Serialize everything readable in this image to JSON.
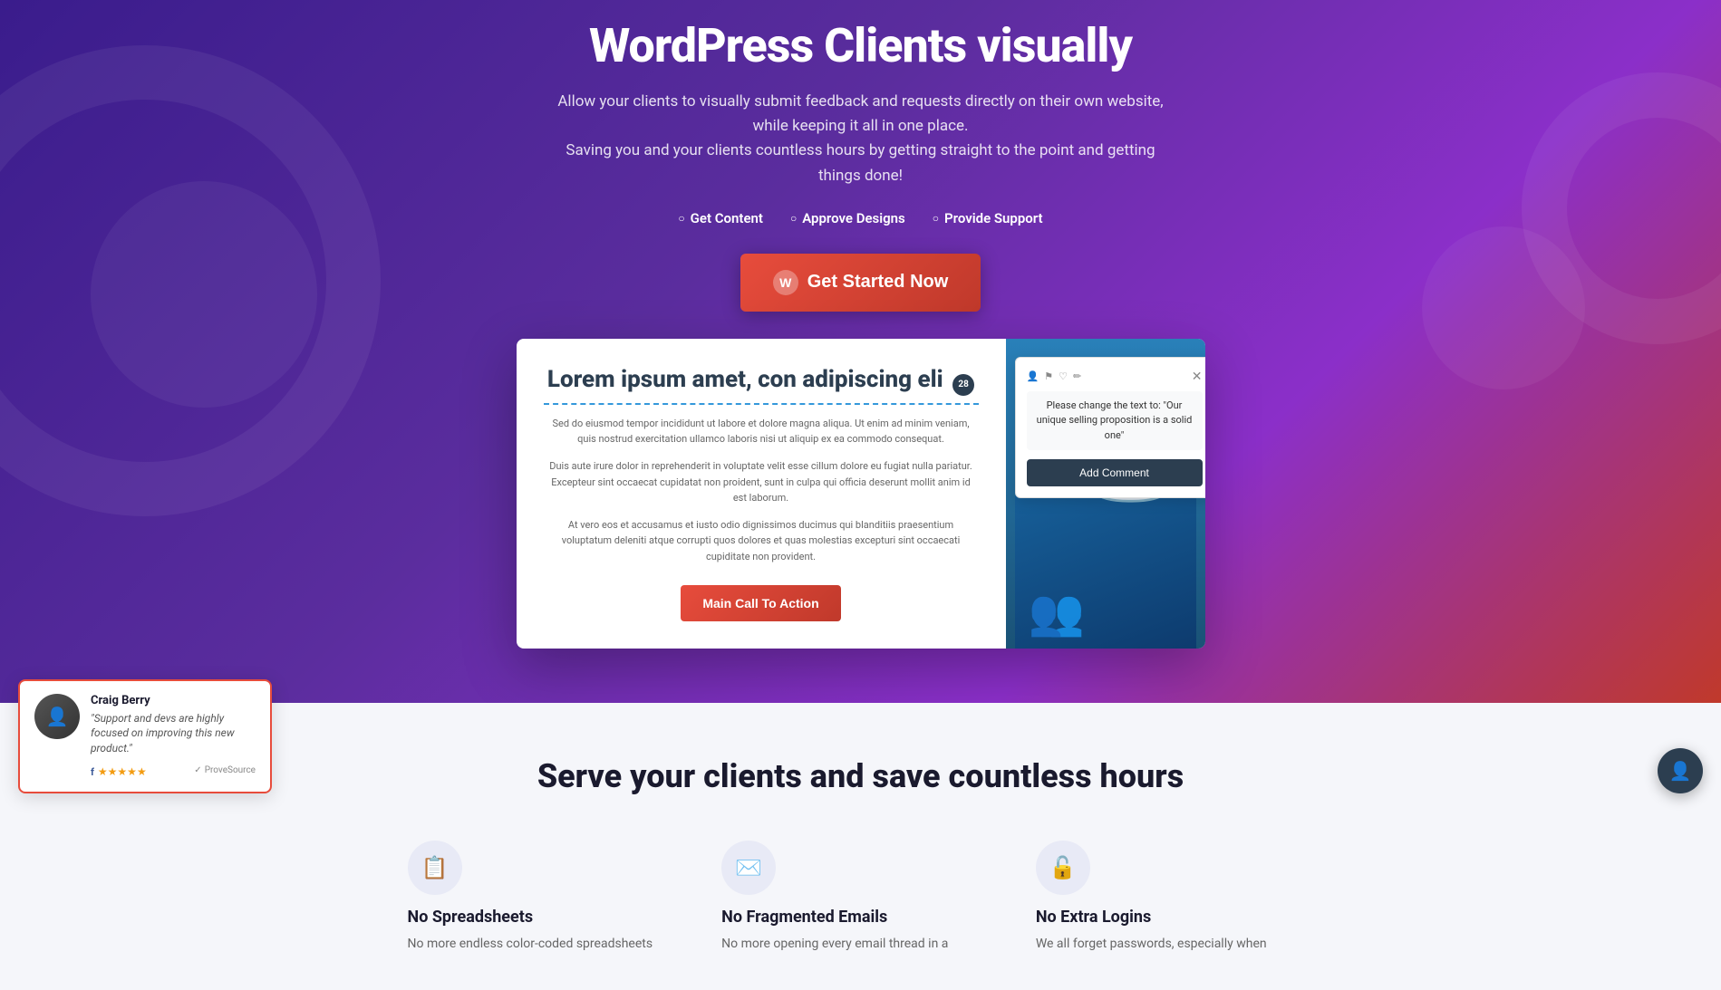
{
  "hero": {
    "title": "WordPress Clients visually",
    "subtitle_line1": "Allow your clients to visually submit feedback and requests directly on their own website, while keeping it all in one place.",
    "subtitle_line2": "Saving you and your clients countless hours by getting straight to the point and getting things done!",
    "features": [
      "Get Content",
      "Approve Designs",
      "Provide Support"
    ],
    "cta_label": "Get Started Now",
    "wp_logo": "W"
  },
  "preview": {
    "heading": "Lorem ipsum amet, con adipiscing eli",
    "badge": "28",
    "para1": "Sed do eiusmod tempor incididunt ut labore et dolore magna aliqua. Ut enim ad minim veniam, quis nostrud exercitation ullamco laboris nisi ut aliquip ex ea commodo consequat.",
    "para2": "Duis aute irure dolor in reprehenderit in voluptate velit esse cillum dolore eu fugiat nulla pariatur. Excepteur sint occaecat cupidatat non proident, sunt in culpa qui officia deserunt mollit anim id est laborum.",
    "para3": "At vero eos et accusamus et iusto odio dignissimos ducimus qui blanditiis praesentium voluptatum deleniti atque corrupti quos dolores et quas molestias excepturi sint occaecati cupiditate non provident.",
    "main_cta": "Main Call To Action",
    "comment_popup": {
      "text": "Please change the text to: \"Our unique selling proposition is a solid one\"",
      "button_label": "Add Comment"
    }
  },
  "lower": {
    "section_title": "Serve your clients and save countless hours",
    "features": [
      {
        "icon": "📋",
        "title": "No Spreadsheets",
        "desc": "No more endless color-coded spreadsheets"
      },
      {
        "icon": "✉️",
        "title": "No Fragmented Emails",
        "desc": "No more opening every email thread in a"
      },
      {
        "icon": "🔓",
        "title": "No Extra Logins",
        "desc": "We all forget passwords, especially when"
      }
    ]
  },
  "testimonial": {
    "name": "Craig Berry",
    "quote": "\"Support and devs are highly focused on improving this new product.\"",
    "stars": "★★★★★",
    "source": "ProveSource"
  },
  "side_tools": {
    "plus": "+",
    "arrow": "↩"
  }
}
